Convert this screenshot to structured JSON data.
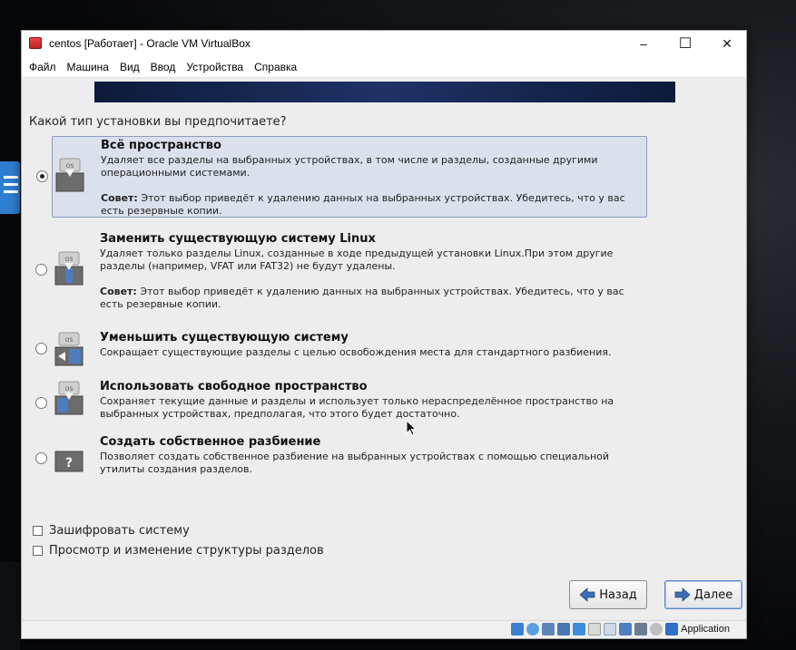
{
  "window": {
    "title": "centos [Работает] - Oracle VM VirtualBox",
    "controls": {
      "minimize": "–",
      "maximize": "☐",
      "close": "✕"
    }
  },
  "menu": [
    "Файл",
    "Машина",
    "Вид",
    "Ввод",
    "Устройства",
    "Справка"
  ],
  "installer": {
    "question": "Какой тип установки вы предпочитаете?",
    "icon_label": "OS",
    "options": [
      {
        "title": "Всё пространство",
        "desc": "Удаляет все разделы на выбранных устройствах, в том числе и разделы, созданные другими операционными системами.",
        "tip_label": "Совет:",
        "tip": "Этот выбор приведёт к удалению данных на выбранных устройствах.  Убедитесь, что у вас есть резервные копии.",
        "selected": true,
        "icon": "drive-erase-all-icon"
      },
      {
        "title": "Заменить существующую систему Linux",
        "desc": "Удаляет только разделы Linux, созданные в ходе предыдущей установки Linux.При этом другие разделы (например, VFAT или FAT32) не будут удалены.",
        "tip_label": "Совет:",
        "tip": "Этот выбор приведёт к удалению данных на выбранных устройствах.  Убедитесь, что у вас есть резервные копии.",
        "selected": false,
        "icon": "drive-replace-linux-icon"
      },
      {
        "title": "Уменьшить существующую систему",
        "desc": "Сокращает существующие разделы с целью освобождения места для стандартного разбиения.",
        "selected": false,
        "icon": "drive-shrink-icon"
      },
      {
        "title": "Использовать свободное пространство",
        "desc": "Сохраняет текущие данные и разделы и использует только нераспределённое пространство на выбранных устройствах, предполагая, что этого будет достаточно.",
        "selected": false,
        "icon": "drive-free-space-icon"
      },
      {
        "title": "Создать собственное разбиение",
        "desc": "Позволяет создать собственное разбиение на выбранных устройствах с помощью специальной утилиты создания разделов.",
        "selected": false,
        "icon": "drive-custom-question-icon",
        "icon_label": "?"
      }
    ],
    "checkboxes": [
      {
        "label": "Зашифровать систему",
        "checked": false
      },
      {
        "label": "Просмотр и изменение структуры разделов",
        "checked": false
      }
    ],
    "buttons": {
      "back": "Назад",
      "next": "Далее"
    }
  },
  "statusbar": {
    "host_key": "Application"
  },
  "colors": {
    "selection_bg": "#dbe1ec",
    "selection_border": "#8c9cbf",
    "banner": "#1f3266"
  }
}
